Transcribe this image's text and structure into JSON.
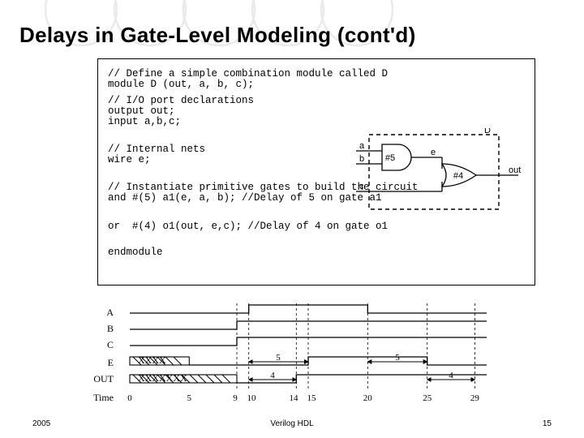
{
  "title": "Delays in Gate-Level Modeling (cont'd)",
  "code": {
    "block1": "// Define a simple combination module called D\nmodule D (out, a, b, c);",
    "block2": "// I/O port declarations\noutput out;\ninput a,b,c;",
    "block3": "// Internal nets\nwire e;",
    "block4": "// Instantiate primitive gates to build the circuit\nand #(5) a1(e, a, b); //Delay of 5 on gate a1",
    "block5": "or  #(4) o1(out, e,c); //Delay of 4 on gate o1",
    "block6": "endmodule"
  },
  "diagram": {
    "label_module": "D",
    "inputs": {
      "a": "a",
      "b": "b",
      "c": "c"
    },
    "signal_e": "e",
    "output": "out",
    "and_delay": "#5",
    "or_delay": "#4"
  },
  "timing": {
    "signals": [
      "A",
      "B",
      "C",
      "E",
      "OUT"
    ],
    "e_unknown": "XXXX",
    "out_unknown": "XXXXXXX",
    "time_label": "Time",
    "ticks": [
      "0",
      "5",
      "9",
      "10",
      "14",
      "15",
      "20",
      "25",
      "29"
    ],
    "arrow_5_a": "5",
    "arrow_5_b": "5",
    "arrow_4_a": "4",
    "arrow_4_b": "4"
  },
  "footer": {
    "left": "2005",
    "mid": "Verilog HDL",
    "right": "15"
  }
}
